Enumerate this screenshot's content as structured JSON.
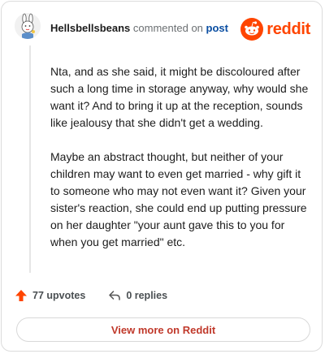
{
  "comment": {
    "author": "Hellsbellsbeans",
    "action_text": "commented on",
    "target_label": "post",
    "paragraphs": [
      "Nta, and as she said, it might be discoloured after such a long time in storage anyway, why would she want it? And to bring it up at the reception, sounds like jealousy that she didn't get a wedding.",
      "Maybe an abstract thought, but neither of your children may want to even get married - why gift it to someone who may not even want it? Given your sister's reaction, she could end up putting pressure on her daughter \"your aunt gave this to you for when you get married\" etc."
    ]
  },
  "brand": {
    "name": "reddit",
    "color": "#ff4500"
  },
  "actions": {
    "upvotes_label": "77 upvotes",
    "replies_label": "0 replies"
  },
  "footer": {
    "view_more_label": "View more on Reddit"
  },
  "icons": {
    "avatar": "bunny-avatar-icon",
    "upvote": "upvote-arrow-icon",
    "reply": "reply-arrow-icon",
    "logo": "reddit-snoo-icon"
  }
}
